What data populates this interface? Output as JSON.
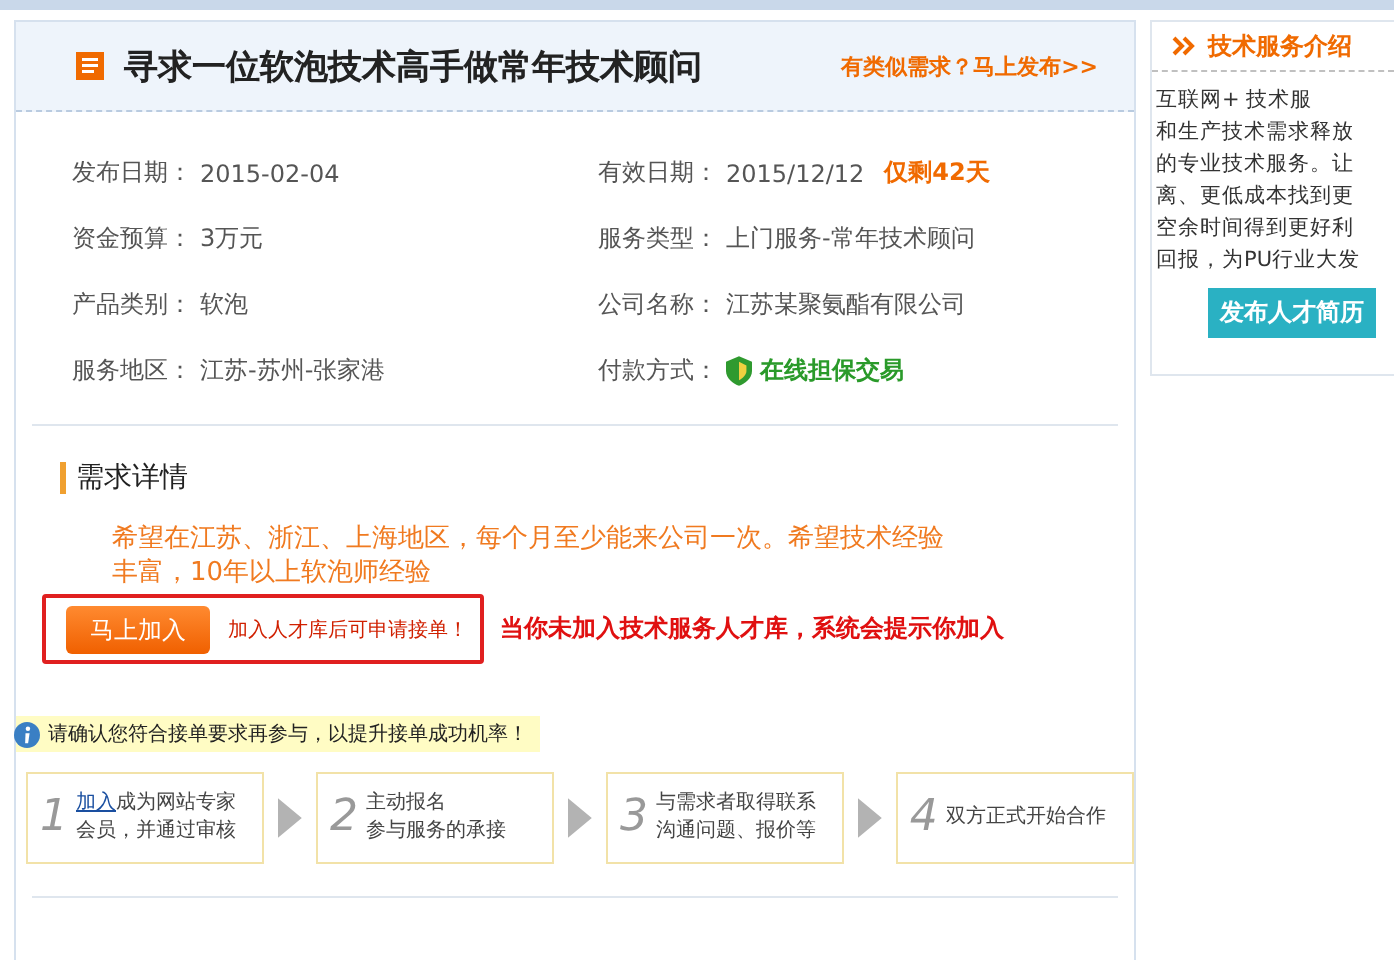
{
  "header": {
    "title": "寻求一位软泡技术高手做常年技术顾问",
    "publish_link": "有类似需求？马上发布>>"
  },
  "info": [
    {
      "label": "发布日期：",
      "value": "2015-02-04"
    },
    {
      "label": "有效日期：",
      "value": "2015/12/12",
      "highlight": "仅剩42天"
    },
    {
      "label": "资金预算：",
      "value": "3万元"
    },
    {
      "label": "服务类型：",
      "value": "上门服务-常年技术顾问"
    },
    {
      "label": "产品类别：",
      "value": "软泡"
    },
    {
      "label": "公司名称：",
      "value": "江苏某聚氨酯有限公司"
    },
    {
      "label": "服务地区：",
      "value": "江苏-苏州-张家港"
    },
    {
      "label": "付款方式：",
      "value": "在线担保交易",
      "kind": "secure"
    }
  ],
  "details": {
    "heading": "需求详情",
    "description": "希望在江苏、浙江、上海地区，每个月至少能来公司一次。希望技术经验丰富，10年以上软泡师经验",
    "join_button": "马上加入",
    "join_note": "加入人才库后可申请接单！",
    "annotation": "当你未加入技术服务人才库，系统会提示你加入"
  },
  "notice": "请确认您符合接单要求再参与，以提升接单成功机率！",
  "steps": [
    {
      "number": "1",
      "link": "加入",
      "lines": [
        "成为网站专家",
        "会员，并通过审核"
      ]
    },
    {
      "number": "2",
      "lines": [
        "主动报名",
        "参与服务的承接"
      ]
    },
    {
      "number": "3",
      "lines": [
        "与需求者取得联系",
        "沟通问题、报价等"
      ]
    },
    {
      "number": "4",
      "lines": [
        "双方正式开始合作"
      ]
    }
  ],
  "sidebar": {
    "title": "技术服务介绍",
    "lines": [
      "互联网+ 技术服",
      "和生产技术需求释放",
      "的专业技术服务。让",
      "离、更低成本找到更",
      "空余时间得到更好利",
      "回报，为PU行业大发"
    ],
    "button": "发布人才简历"
  }
}
